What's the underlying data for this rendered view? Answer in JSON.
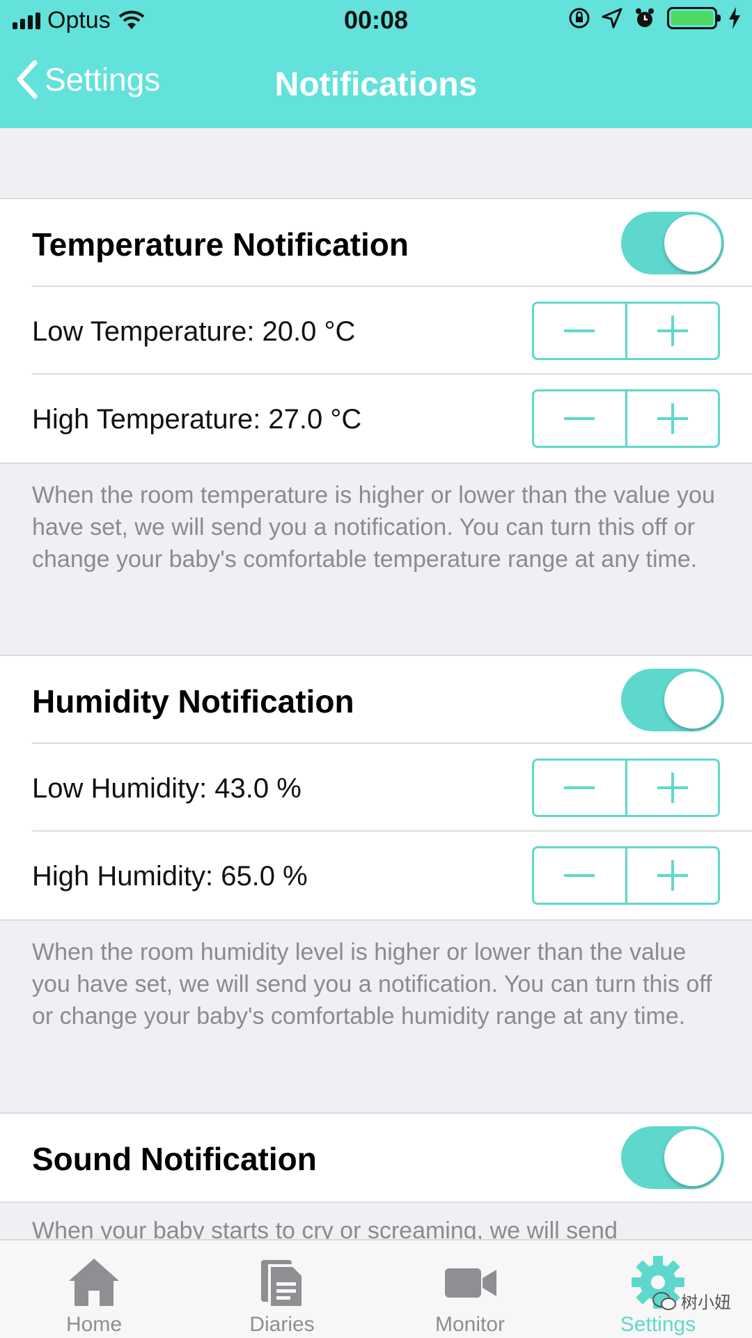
{
  "status_bar": {
    "carrier": "Optus",
    "time": "00:08",
    "battery_color": "#4cd964"
  },
  "nav": {
    "back_label": "Settings",
    "title": "Notifications"
  },
  "colors": {
    "accent": "#5ed8cd",
    "header": "#62e2da",
    "background": "#efeff4"
  },
  "temperature": {
    "title": "Temperature Notification",
    "enabled": true,
    "low_label": "Low Temperature: 20.0 °C",
    "high_label": "High Temperature: 27.0 °C",
    "description": "When the room temperature is higher or lower than the value you have set, we will send you a notification. You can turn this off or change your baby's comfortable temperature range at any time."
  },
  "humidity": {
    "title": "Humidity Notification",
    "enabled": true,
    "low_label": "Low Humidity: 43.0 %",
    "high_label": "High Humidity: 65.0 %",
    "description": "When the room humidity level is higher or lower than the value you have set, we will send you a notification. You can turn this off or change your baby's comfortable humidity range at any time."
  },
  "sound": {
    "title": "Sound Notification",
    "enabled": true,
    "description": "When your baby starts to cry or screaming, we will send"
  },
  "tabs": [
    {
      "label": "Home",
      "icon": "home-icon",
      "active": false
    },
    {
      "label": "Diaries",
      "icon": "document-icon",
      "active": false
    },
    {
      "label": "Monitor",
      "icon": "video-camera-icon",
      "active": false
    },
    {
      "label": "Settings",
      "icon": "gear-icon",
      "active": true
    }
  ],
  "watermark": "树小妞"
}
